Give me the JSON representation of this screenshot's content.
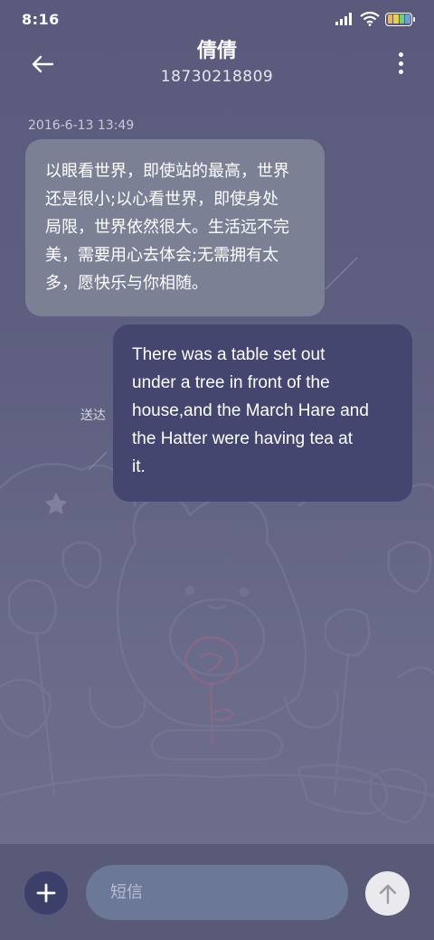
{
  "status_bar": {
    "time": "8:16",
    "icons": [
      "signal-icon",
      "wifi-icon",
      "battery-icon"
    ],
    "battery_colors": [
      "#f0b44a",
      "#e8d24a",
      "#7dc87a",
      "#6aa0e0"
    ]
  },
  "header": {
    "contact_name": "倩倩",
    "contact_number": "18730218809",
    "back_icon": "back-arrow-icon",
    "more_icon": "more-vertical-icon"
  },
  "conversation": {
    "timestamp": "2016-6-13 13:49",
    "incoming_message": {
      "lines": [
        "以眼看世界，即使站的最高，世界",
        "还是很小;以心看世界，即使身处",
        "局限，世界依然很大。生活远不完",
        "美，需要用心去体会;无需拥有太",
        "多，愿快乐与你相随。"
      ]
    },
    "outgoing_message": {
      "status": "送达",
      "lines": [
        "There was a table set out",
        "under a tree in front of the",
        "house,and the March Hare and",
        "the Hatter were having tea at",
        "it."
      ]
    }
  },
  "composer": {
    "placeholder": "短信",
    "add_icon": "plus-icon",
    "send_icon": "arrow-up-icon"
  },
  "colors": {
    "background": "#5c5e7e",
    "incoming_bubble": "#7b8095",
    "outgoing_bubble": "#444670",
    "composer_bar": "#595a78",
    "add_button": "#3d3f6b",
    "input_field": "#6b7898",
    "send_button": "#e9e9ee"
  }
}
